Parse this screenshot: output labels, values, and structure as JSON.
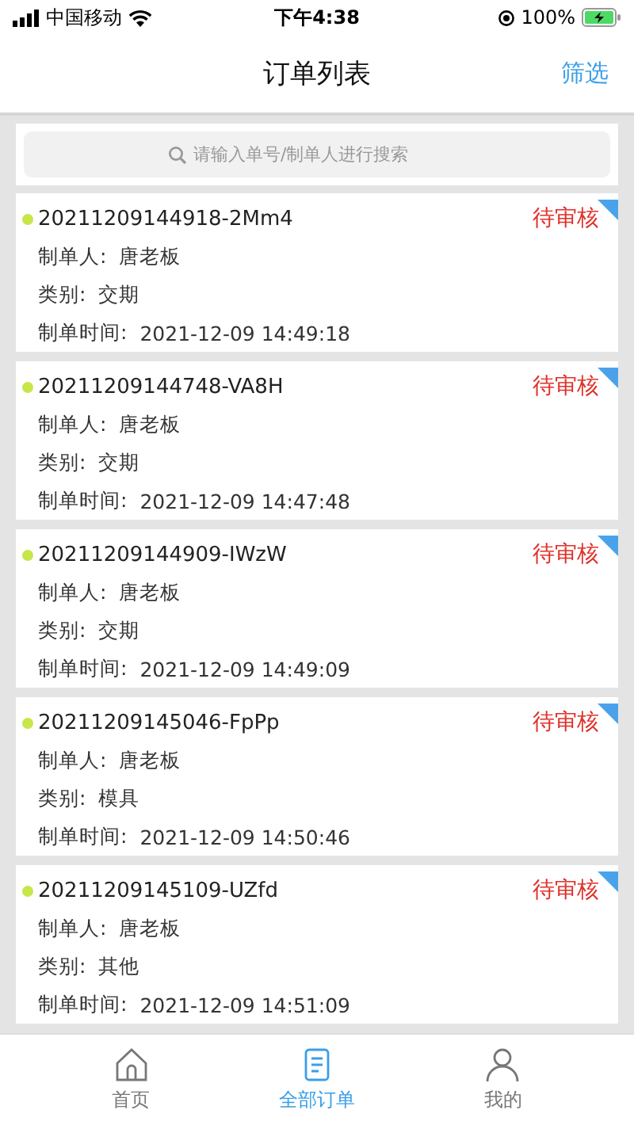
{
  "status_bar": {
    "carrier": "中国移动",
    "time": "下午4:38",
    "battery": "100%"
  },
  "nav": {
    "title": "订单列表",
    "action": "筛选"
  },
  "search": {
    "placeholder": "请输入单号/制单人进行搜索"
  },
  "orders": [
    {
      "number": "20211209144918-2Mm4",
      "status": "待审核",
      "creator_label": "制单人:",
      "creator": "唐老板",
      "type_label": "类别:",
      "type": "交期",
      "time_label": "制单时间:",
      "time": "2021-12-09 14:49:18",
      "color": "#c8e64a"
    },
    {
      "number": "20211209144748-VA8H",
      "status": "待审核",
      "creator_label": "制单人:",
      "creator": "唐老板",
      "type_label": "类别:",
      "type": "交期",
      "time_label": "制单时间:",
      "time": "2021-12-09 14:47:48",
      "color": "#c8e64a"
    },
    {
      "number": "20211209144909-IWzW",
      "status": "待审核",
      "creator_label": "制单人:",
      "creator": "唐老板",
      "type_label": "类别:",
      "type": "交期",
      "time_label": "制单时间:",
      "time": "2021-12-09 14:49:09",
      "color": "#c8e64a"
    },
    {
      "number": "20211209145046-FpPp",
      "status": "待审核",
      "creator_label": "制单人:",
      "creator": "唐老板",
      "type_label": "类别:",
      "type": "模具",
      "time_label": "制单时间:",
      "time": "2021-12-09 14:50:46",
      "color": "#c8e64a"
    },
    {
      "number": "20211209145109-UZfd",
      "status": "待审核",
      "creator_label": "制单人:",
      "creator": "唐老板",
      "type_label": "类别:",
      "type": "其他",
      "time_label": "制单时间:",
      "time": "2021-12-09 14:51:09",
      "color": "#c8e64a"
    }
  ],
  "tabs": [
    {
      "kind": "home",
      "label": "首页",
      "selected": false
    },
    {
      "kind": "orders",
      "label": "全部订单",
      "selected": true
    },
    {
      "kind": "me",
      "label": "我的",
      "selected": false
    }
  ]
}
